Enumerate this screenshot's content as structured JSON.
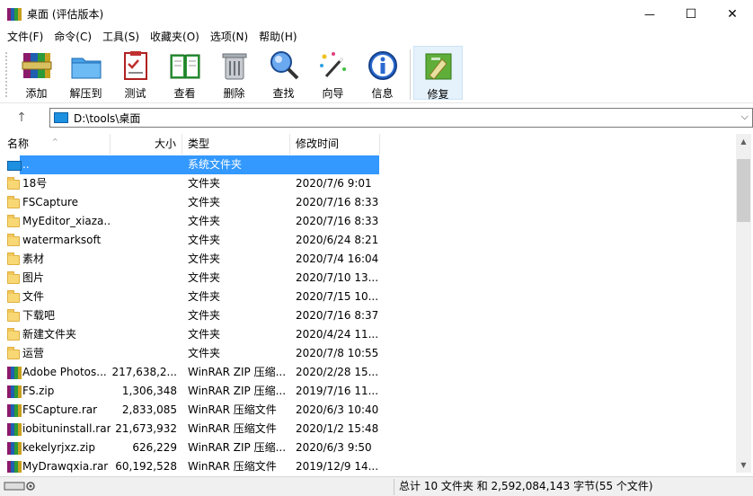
{
  "window": {
    "title": "桌面 (评估版本)",
    "minimize_glyph": "—",
    "maximize_glyph": "☐",
    "close_glyph": "✕"
  },
  "menu": [
    "文件(F)",
    "命令(C)",
    "工具(S)",
    "收藏夹(O)",
    "选项(N)",
    "帮助(H)"
  ],
  "toolbar": [
    {
      "label": "添加",
      "icon": "add-archive-icon"
    },
    {
      "label": "解压到",
      "icon": "extract-to-icon"
    },
    {
      "label": "测试",
      "icon": "test-icon"
    },
    {
      "label": "查看",
      "icon": "view-icon"
    },
    {
      "label": "删除",
      "icon": "delete-icon"
    },
    {
      "label": "查找",
      "icon": "find-icon"
    },
    {
      "label": "向导",
      "icon": "wizard-icon"
    },
    {
      "label": "信息",
      "icon": "info-icon"
    },
    {
      "label": "修复",
      "icon": "repair-icon"
    }
  ],
  "address": {
    "path": "D:\\tools\\桌面",
    "up_glyph": "↑",
    "dropdown_glyph": "⌵"
  },
  "columns": {
    "name": "名称",
    "size": "大小",
    "type": "类型",
    "modified": "修改时间",
    "sort_glyph": "^"
  },
  "files": [
    {
      "name": "..",
      "size": "",
      "type": "系统文件夹",
      "modified": "",
      "kind": "up",
      "selected": true
    },
    {
      "name": "18号",
      "size": "",
      "type": "文件夹",
      "modified": "2020/7/6 9:01",
      "kind": "folder"
    },
    {
      "name": "FSCapture",
      "size": "",
      "type": "文件夹",
      "modified": "2020/7/16 8:33",
      "kind": "folder"
    },
    {
      "name": "MyEditor_xiaza...",
      "size": "",
      "type": "文件夹",
      "modified": "2020/7/16 8:33",
      "kind": "folder"
    },
    {
      "name": "watermarksoft",
      "size": "",
      "type": "文件夹",
      "modified": "2020/6/24 8:21",
      "kind": "folder"
    },
    {
      "name": "素材",
      "size": "",
      "type": "文件夹",
      "modified": "2020/7/4 16:04",
      "kind": "folder"
    },
    {
      "name": "图片",
      "size": "",
      "type": "文件夹",
      "modified": "2020/7/10 13...",
      "kind": "folder"
    },
    {
      "name": "文件",
      "size": "",
      "type": "文件夹",
      "modified": "2020/7/15 10...",
      "kind": "folder"
    },
    {
      "name": "下载吧",
      "size": "",
      "type": "文件夹",
      "modified": "2020/7/16 8:37",
      "kind": "folder"
    },
    {
      "name": "新建文件夹",
      "size": "",
      "type": "文件夹",
      "modified": "2020/4/24 11...",
      "kind": "folder"
    },
    {
      "name": "运营",
      "size": "",
      "type": "文件夹",
      "modified": "2020/7/8 10:55",
      "kind": "folder"
    },
    {
      "name": "Adobe Photos...",
      "size": "217,638,2...",
      "type": "WinRAR ZIP 压缩...",
      "modified": "2020/2/28 15...",
      "kind": "archive"
    },
    {
      "name": "FS.zip",
      "size": "1,306,348",
      "type": "WinRAR ZIP 压缩...",
      "modified": "2019/7/16 11...",
      "kind": "archive"
    },
    {
      "name": "FSCapture.rar",
      "size": "2,833,085",
      "type": "WinRAR 压缩文件",
      "modified": "2020/6/3 10:40",
      "kind": "archive"
    },
    {
      "name": "iobituninstall.rar",
      "size": "21,673,932",
      "type": "WinRAR 压缩文件",
      "modified": "2020/1/2 15:48",
      "kind": "archive"
    },
    {
      "name": "kekelyrjxz.zip",
      "size": "626,229",
      "type": "WinRAR ZIP 压缩...",
      "modified": "2020/6/3 9:50",
      "kind": "archive"
    },
    {
      "name": "MyDrawqxia.rar",
      "size": "60,192,528",
      "type": "WinRAR 压缩文件",
      "modified": "2019/12/9 14...",
      "kind": "archive"
    }
  ],
  "scrollbar": {
    "up_glyph": "▲",
    "down_glyph": "▼"
  },
  "status": {
    "summary": "总计 10 文件夹 和 2,592,084,143 字节(55 个文件)"
  }
}
